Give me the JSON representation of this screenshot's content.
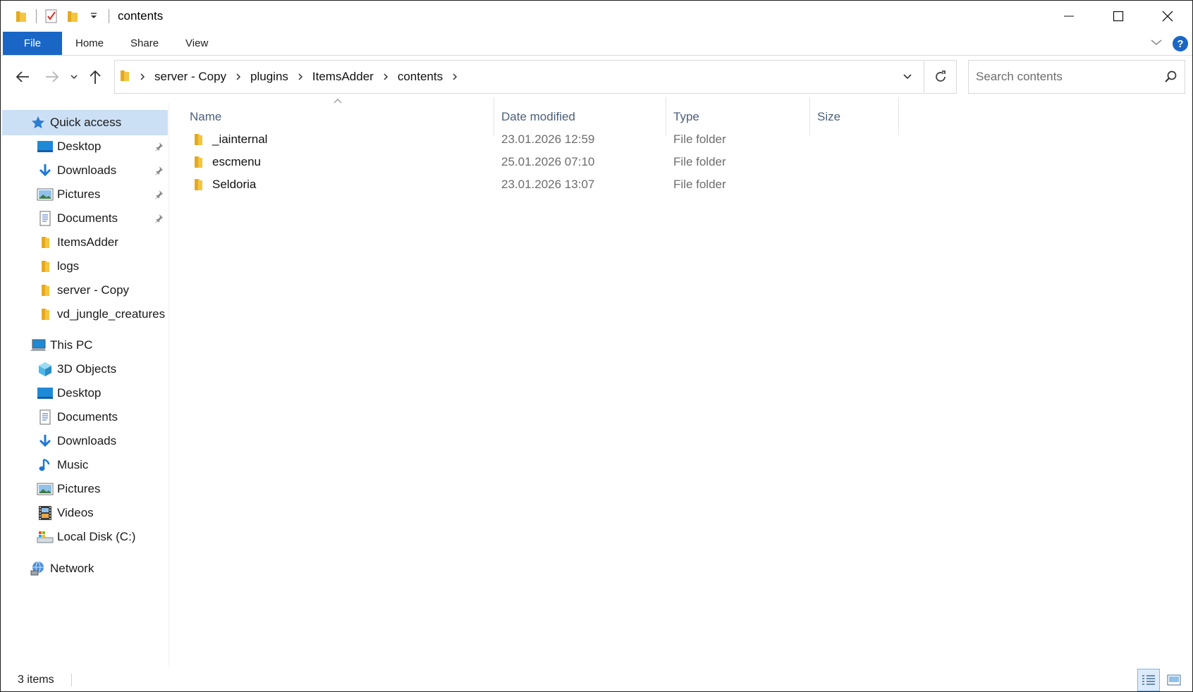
{
  "window": {
    "title": "contents",
    "controls": [
      "minimize-icon",
      "maximize-icon",
      "close-icon"
    ]
  },
  "ribbon": {
    "tabs": [
      "File",
      "Home",
      "Share",
      "View"
    ]
  },
  "address": {
    "crumbs": [
      "server - Copy",
      "plugins",
      "ItemsAdder",
      "contents"
    ]
  },
  "search": {
    "placeholder": "Search contents"
  },
  "sidebar": {
    "quick_access": "Quick access",
    "quick_items": [
      "Desktop",
      "Downloads",
      "Pictures",
      "Documents",
      "ItemsAdder",
      "logs",
      "server - Copy",
      "vd_jungle_creatures"
    ],
    "this_pc": "This PC",
    "pc_items": [
      "3D Objects",
      "Desktop",
      "Documents",
      "Downloads",
      "Music",
      "Pictures",
      "Videos",
      "Local Disk (C:)"
    ],
    "network": "Network"
  },
  "columns": {
    "name": "Name",
    "date": "Date modified",
    "type": "Type",
    "size": "Size"
  },
  "files": [
    {
      "name": "_iainternal",
      "date": "23.01.2026 12:59",
      "type": "File folder"
    },
    {
      "name": "escmenu",
      "date": "25.01.2026 07:10",
      "type": "File folder"
    },
    {
      "name": "Seldoria",
      "date": "23.01.2026 13:07",
      "type": "File folder"
    }
  ],
  "status": {
    "count": "3 items"
  },
  "colors": {
    "accent": "#1a66c7",
    "selection": "#cce0f5",
    "folder": "#f4c542"
  }
}
